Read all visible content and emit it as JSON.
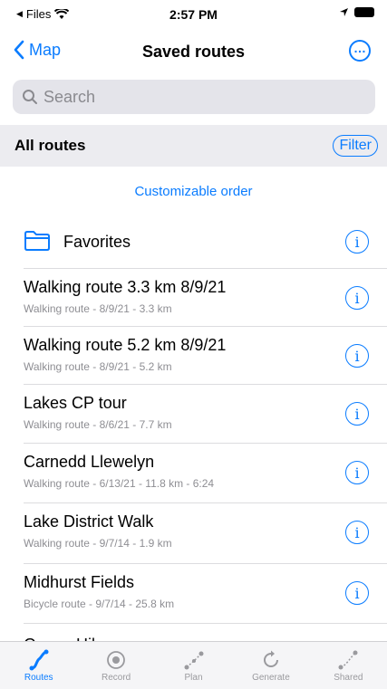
{
  "status": {
    "back_app": "Files",
    "time": "2:57 PM"
  },
  "nav": {
    "back_label": "Map",
    "title": "Saved routes"
  },
  "search": {
    "placeholder": "Search"
  },
  "section": {
    "title": "All routes",
    "filter_label": "Filter"
  },
  "customizable_label": "Customizable order",
  "favorites_label": "Favorites",
  "routes": [
    {
      "name": "Walking route 3.3 km 8/9/21",
      "details": "Walking route - 8/9/21 - 3.3 km"
    },
    {
      "name": "Walking route 5.2 km 8/9/21",
      "details": "Walking route - 8/9/21 - 5.2 km"
    },
    {
      "name": "Lakes CP tour",
      "details": "Walking route - 8/6/21 - 7.7 km"
    },
    {
      "name": "Carnedd Llewelyn",
      "details": "Walking route - 6/13/21 - 11.8 km - 6:24"
    },
    {
      "name": "Lake District Walk",
      "details": "Walking route - 9/7/14 - 1.9 km"
    },
    {
      "name": "Midhurst Fields",
      "details": "Bicycle route - 9/7/14 - 25.8 km"
    }
  ],
  "partial_route_name": "Gower Hike",
  "tabs": [
    {
      "label": "Routes",
      "icon": "routes-icon",
      "active": true
    },
    {
      "label": "Record",
      "icon": "record-icon",
      "active": false
    },
    {
      "label": "Plan",
      "icon": "plan-icon",
      "active": false
    },
    {
      "label": "Generate",
      "icon": "generate-icon",
      "active": false
    },
    {
      "label": "Shared",
      "icon": "shared-icon",
      "active": false
    }
  ],
  "colors": {
    "accent": "#0a7cff",
    "section_bg": "#ececf0",
    "search_bg": "#e4e4ea",
    "subtitle": "#8e8e93"
  }
}
